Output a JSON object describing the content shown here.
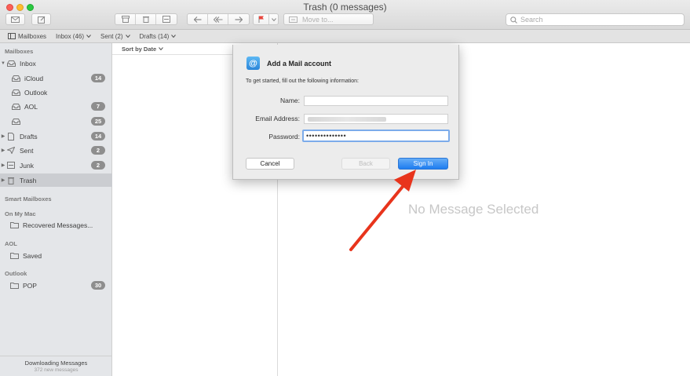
{
  "window": {
    "title": "Trash (0 messages)"
  },
  "toolbar": {
    "buttons": [
      {
        "name": "compose-new-icon"
      },
      {
        "name": "compose-edit-icon"
      }
    ],
    "move_to": {
      "label": "Move to..."
    },
    "search": {
      "placeholder": "Search"
    }
  },
  "favorites": {
    "mailboxes": "Mailboxes",
    "inbox": "Inbox (46)",
    "sent": "Sent (2)",
    "drafts": "Drafts (14)"
  },
  "sidebar": {
    "mailboxes_heading": "Mailboxes",
    "items": [
      {
        "label": "Inbox",
        "badge": ""
      },
      {
        "label": "iCloud",
        "badge": "14"
      },
      {
        "label": "Outlook",
        "badge": ""
      },
      {
        "label": "AOL",
        "badge": "7"
      },
      {
        "label": "",
        "badge": "25"
      },
      {
        "label": "Drafts",
        "badge": "14"
      },
      {
        "label": "Sent",
        "badge": "2"
      },
      {
        "label": "Junk",
        "badge": "2"
      },
      {
        "label": "Trash",
        "badge": ""
      }
    ],
    "smart_heading": "Smart Mailboxes",
    "on_my_mac_heading": "On My Mac",
    "recovered": "Recovered Messages...",
    "aol_heading": "AOL",
    "saved": "Saved",
    "outlook_heading": "Outlook",
    "pop": {
      "label": "POP",
      "badge": "30"
    },
    "status": {
      "main": "Downloading Messages",
      "sub": "372 new messages"
    }
  },
  "message_list": {
    "sort_label": "Sort by Date"
  },
  "viewer": {
    "empty_text": "No Message Selected"
  },
  "dialog": {
    "title": "Add a Mail account",
    "description": "To get started, fill out the following information:",
    "name_label": "Name:",
    "name_value": "",
    "email_label": "Email Address:",
    "password_label": "Password:",
    "password_value": "••••••••••••••",
    "cancel": "Cancel",
    "back": "Back",
    "sign_in": "Sign In"
  },
  "colors": {
    "accent": "#1e7cf0",
    "arrow": "#e8341c",
    "badge": "#8e8e8e"
  }
}
